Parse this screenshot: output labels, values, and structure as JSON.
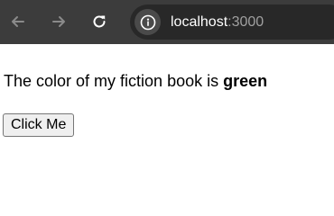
{
  "browser": {
    "back_icon": "arrow-left-icon",
    "forward_icon": "arrow-right-icon",
    "reload_icon": "reload-icon",
    "site_info_icon": "info-icon",
    "url_host": "localhost",
    "url_port": ":3000",
    "colors": {
      "toolbar": "#3c3c3c",
      "omnibox": "#282828",
      "icon": "#c8c8c8"
    }
  },
  "page": {
    "sentence_prefix": "The color of my fiction book is ",
    "color_value": "green",
    "button_label": "Click Me"
  }
}
